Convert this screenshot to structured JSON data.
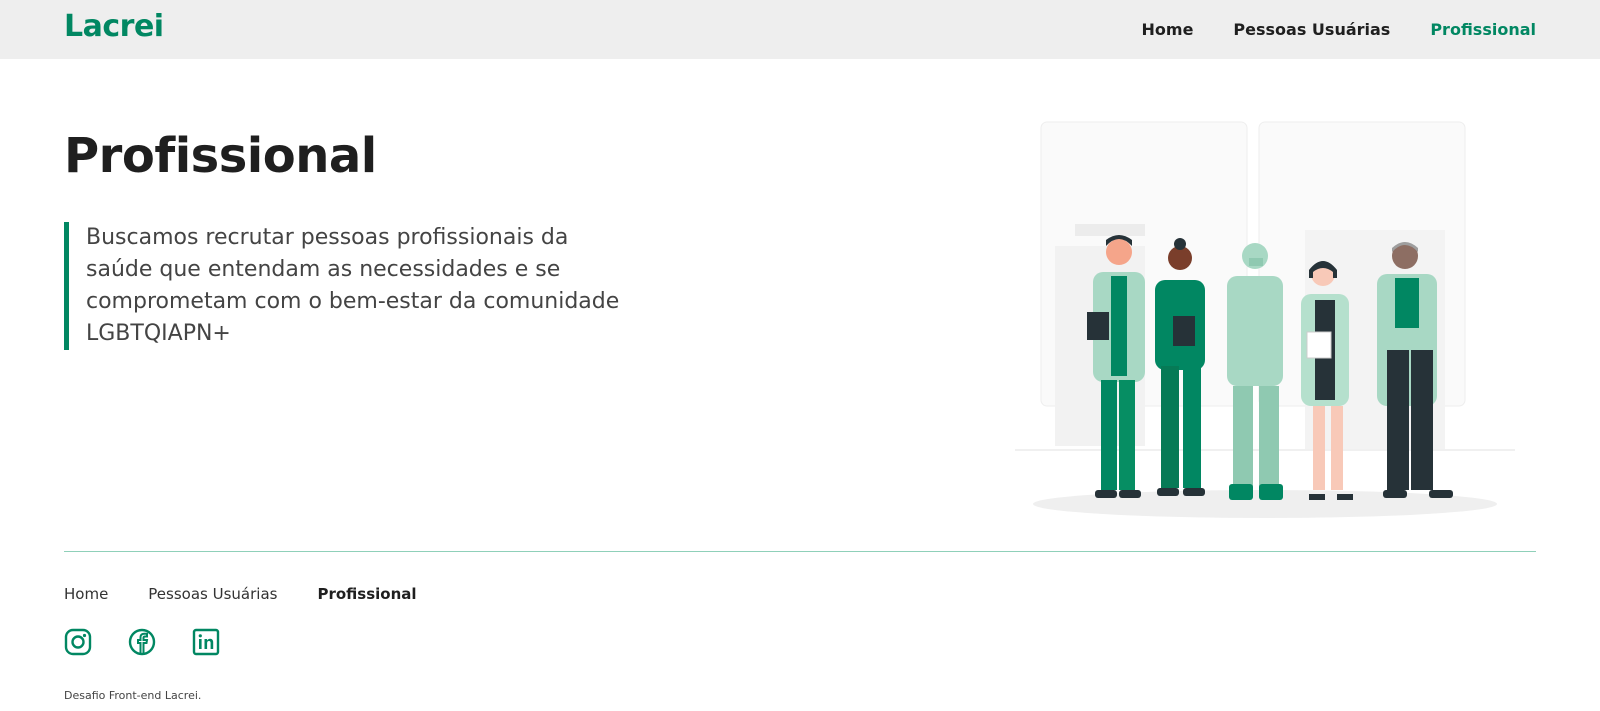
{
  "header": {
    "logo": "Lacrei",
    "nav": [
      {
        "label": "Home"
      },
      {
        "label": "Pessoas Usuárias"
      },
      {
        "label": "Profissional"
      }
    ]
  },
  "main": {
    "title": "Profissional",
    "quote": "Buscamos recrutar pessoas profissionais da saúde que entendam as necessidades e se comprometam com o bem-estar da comunidade LGBTQIAPN+",
    "illustration_icon": "healthcare-team-illustration"
  },
  "footer": {
    "nav": [
      {
        "label": "Home"
      },
      {
        "label": "Pessoas Usuárias"
      },
      {
        "label": "Profissional"
      }
    ],
    "social_icons": [
      "instagram-icon",
      "facebook-icon",
      "linkedin-icon"
    ],
    "copyright": "Desafio Front-end Lacrei."
  },
  "colors": {
    "accent": "#018762",
    "header_bg": "#eeeeee",
    "divider": "#8fd0b9",
    "text": "#1f1f1f"
  }
}
